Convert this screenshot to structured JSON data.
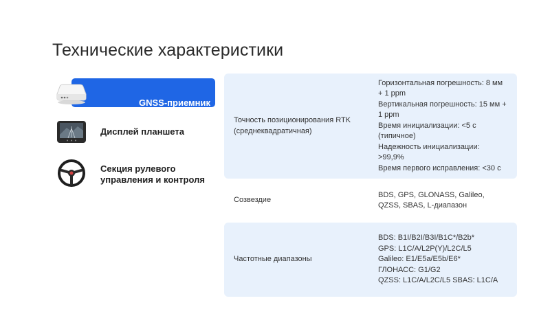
{
  "page": {
    "title": "Технические характеристики"
  },
  "nav": {
    "items": [
      {
        "label": "GNSS-приемник",
        "icon": "gnss-receiver-icon",
        "active": true
      },
      {
        "label": "Дисплей планшета",
        "icon": "tablet-display-icon",
        "active": false
      },
      {
        "label": "Секция рулевого управления и контроля",
        "icon": "steering-wheel-icon",
        "active": false
      }
    ]
  },
  "specs": {
    "rows": [
      {
        "key": "Точность позиционирования RTK (среднеквадратичная)",
        "values": [
          "Горизонтальная погрешность: 8 мм + 1 ppm",
          "Вертикальная погрешность: 15 мм + 1 ppm",
          "Время инициализации: <5 с (типичное)",
          "Надежность инициализации: >99,9%",
          "Время первого исправления: <30 с"
        ]
      },
      {
        "key": "Созвездие",
        "values": [
          "BDS, GPS, GLONASS, Galileo, QZSS, SBAS, L-диапазон"
        ]
      },
      {
        "key": "Частотные диапазоны",
        "values": [
          "BDS: B1I/B2I/B3I/B1C*/B2b*",
          "GPS: L1C/A/L2P(Y)/L2C/L5",
          "Galileo: E1/E5a/E5b/E6*",
          "ГЛОНАСС: G1/G2",
          "QZSS: L1C/A/L2C/L5 SBAS: L1C/A"
        ]
      }
    ]
  },
  "colors": {
    "accent": "#1f66e5",
    "row_bg": "#e8f1fc"
  }
}
